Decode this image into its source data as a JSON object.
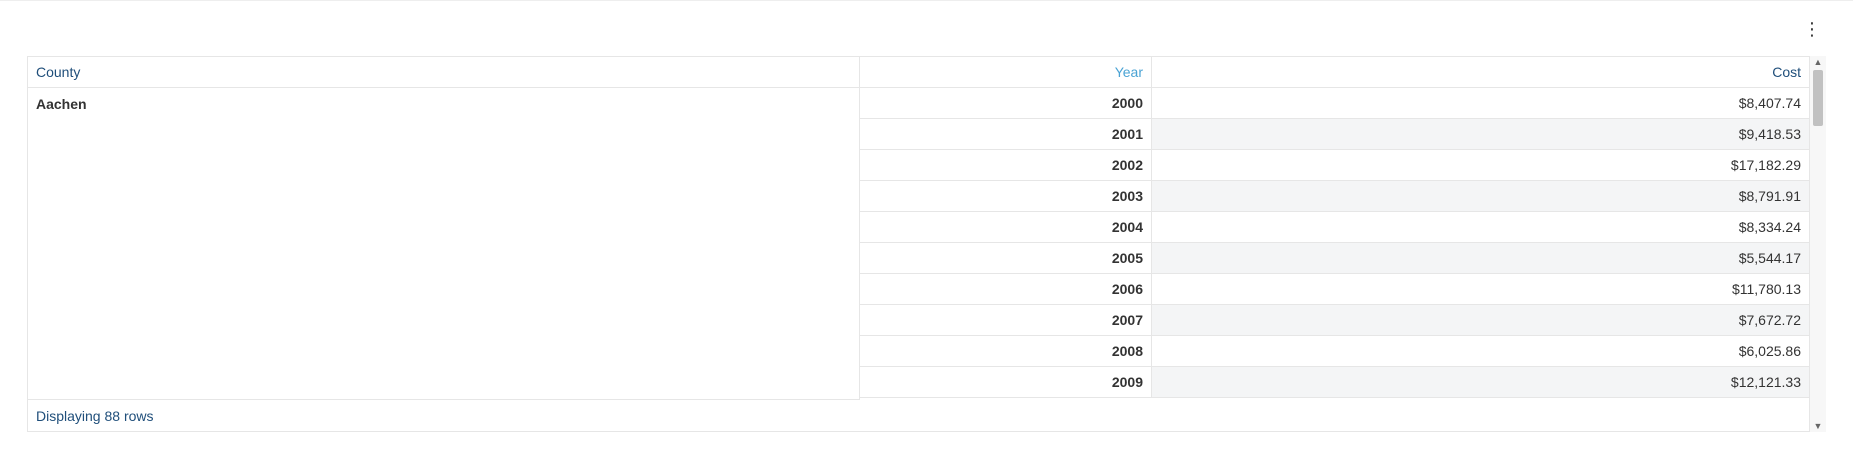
{
  "toolbar": {
    "menu_icon": "kebab-menu-icon",
    "menu_glyph": "⋮"
  },
  "table": {
    "headers": {
      "county": "County",
      "year": "Year",
      "cost": "Cost"
    },
    "active_sort_column": "Year",
    "group": {
      "county": "Aachen"
    },
    "rows": [
      {
        "year": "2000",
        "cost": "$8,407.74"
      },
      {
        "year": "2001",
        "cost": "$9,418.53"
      },
      {
        "year": "2002",
        "cost": "$17,182.29"
      },
      {
        "year": "2003",
        "cost": "$8,791.91"
      },
      {
        "year": "2004",
        "cost": "$8,334.24"
      },
      {
        "year": "2005",
        "cost": "$5,544.17"
      },
      {
        "year": "2006",
        "cost": "$11,780.13"
      },
      {
        "year": "2007",
        "cost": "$7,672.72"
      },
      {
        "year": "2008",
        "cost": "$6,025.86"
      },
      {
        "year": "2009",
        "cost": "$12,121.33"
      }
    ],
    "footer": "Displaying 88 rows"
  },
  "scrollbar": {
    "up_glyph": "▲",
    "down_glyph": "▼"
  },
  "colors": {
    "header_text": "#1f4e7a",
    "active_header": "#4aa3d4",
    "alt_row": "#f4f5f6",
    "border": "#e6e6e6"
  }
}
